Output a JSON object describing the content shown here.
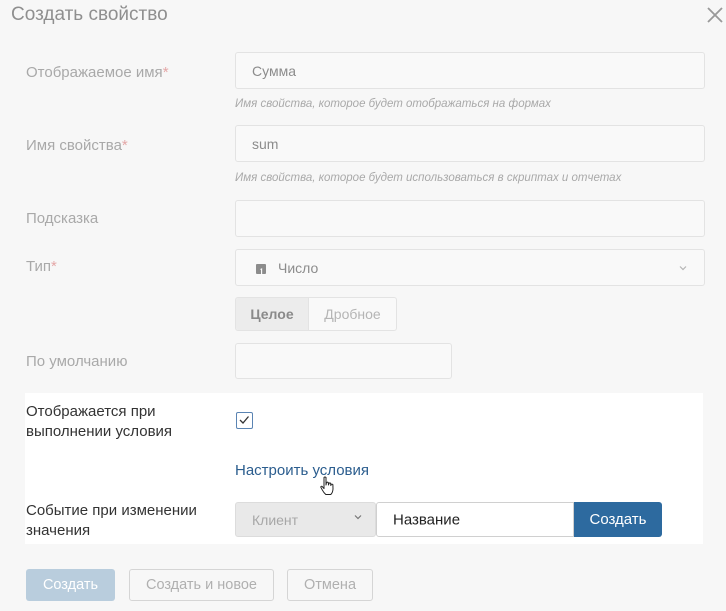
{
  "dialog": {
    "title": "Создать свойство",
    "close_icon": "close-icon"
  },
  "form": {
    "display_name": {
      "label": "Отображаемое имя",
      "required_mark": "*",
      "value": "Сумма",
      "hint": "Имя свойства, которое будет отображаться на формах"
    },
    "property_name": {
      "label": "Имя свойства",
      "required_mark": "*",
      "value": "sum",
      "hint": "Имя свойства, которое будет использоваться в скриптах и отчетах"
    },
    "tooltip": {
      "label": "Подсказка",
      "value": ""
    },
    "type": {
      "label": "Тип",
      "required_mark": "*",
      "value": "Число",
      "type_icon": "number-type-icon"
    },
    "number_format": {
      "options": [
        "Целое",
        "Дробное"
      ],
      "selected": "Целое"
    },
    "default": {
      "label": "По умолчанию",
      "value": ""
    }
  },
  "condition": {
    "label": "Отображается при выполнении условия",
    "checked": true,
    "configure_link": "Настроить условия"
  },
  "event": {
    "label": "Событие при изменении значения",
    "source": "Клиент",
    "name_value": "Название",
    "create_label": "Создать"
  },
  "footer": {
    "create": "Создать",
    "create_and_new": "Создать и новое",
    "cancel": "Отмена"
  },
  "colors": {
    "link": "#2b5d8e",
    "primary_button": "#2d6a9f",
    "required": "#e4a7a7"
  }
}
